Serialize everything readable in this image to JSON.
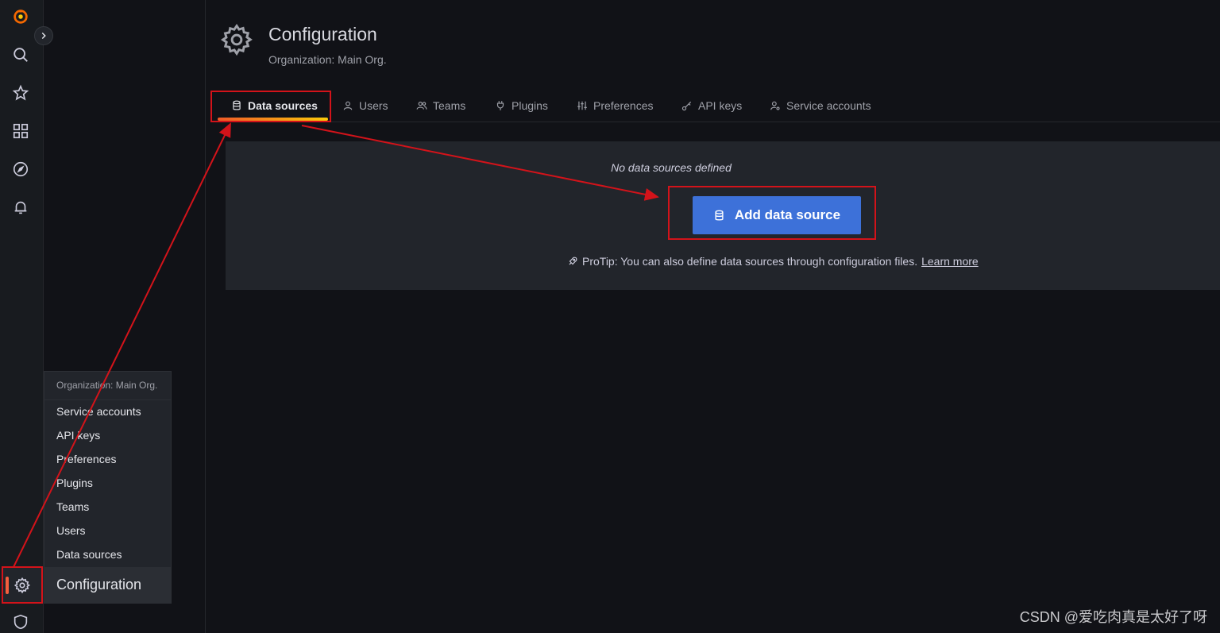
{
  "header": {
    "title": "Configuration",
    "subtitle": "Organization: Main Org."
  },
  "tabs": [
    {
      "label": "Data sources",
      "icon": "database-icon",
      "active": true
    },
    {
      "label": "Users",
      "icon": "user-icon"
    },
    {
      "label": "Teams",
      "icon": "users-icon"
    },
    {
      "label": "Plugins",
      "icon": "plug-icon"
    },
    {
      "label": "Preferences",
      "icon": "sliders-icon"
    },
    {
      "label": "API keys",
      "icon": "key-icon"
    },
    {
      "label": "Service accounts",
      "icon": "user-cog-icon"
    }
  ],
  "empty_state": {
    "message": "No data sources defined",
    "button_label": "Add data source",
    "protip_text": "ProTip: You can also define data sources through configuration files.",
    "learn_more": "Learn more"
  },
  "flyout": {
    "header": "Organization: Main Org.",
    "items": [
      "Service accounts",
      "API keys",
      "Preferences",
      "Plugins",
      "Teams",
      "Users",
      "Data sources"
    ],
    "footer": "Configuration"
  },
  "rail_icons": [
    "grafana-logo-icon",
    "search-icon",
    "star-icon",
    "dashboards-icon",
    "compass-icon",
    "bell-icon",
    "gear-icon",
    "shield-icon"
  ],
  "colors": {
    "accent_blue": "#3d71d9",
    "annotation_red": "#d3131a",
    "tab_gradient_start": "#f05a28",
    "tab_gradient_end": "#fbca0a"
  },
  "watermark": "CSDN @爱吃肉真是太好了呀"
}
